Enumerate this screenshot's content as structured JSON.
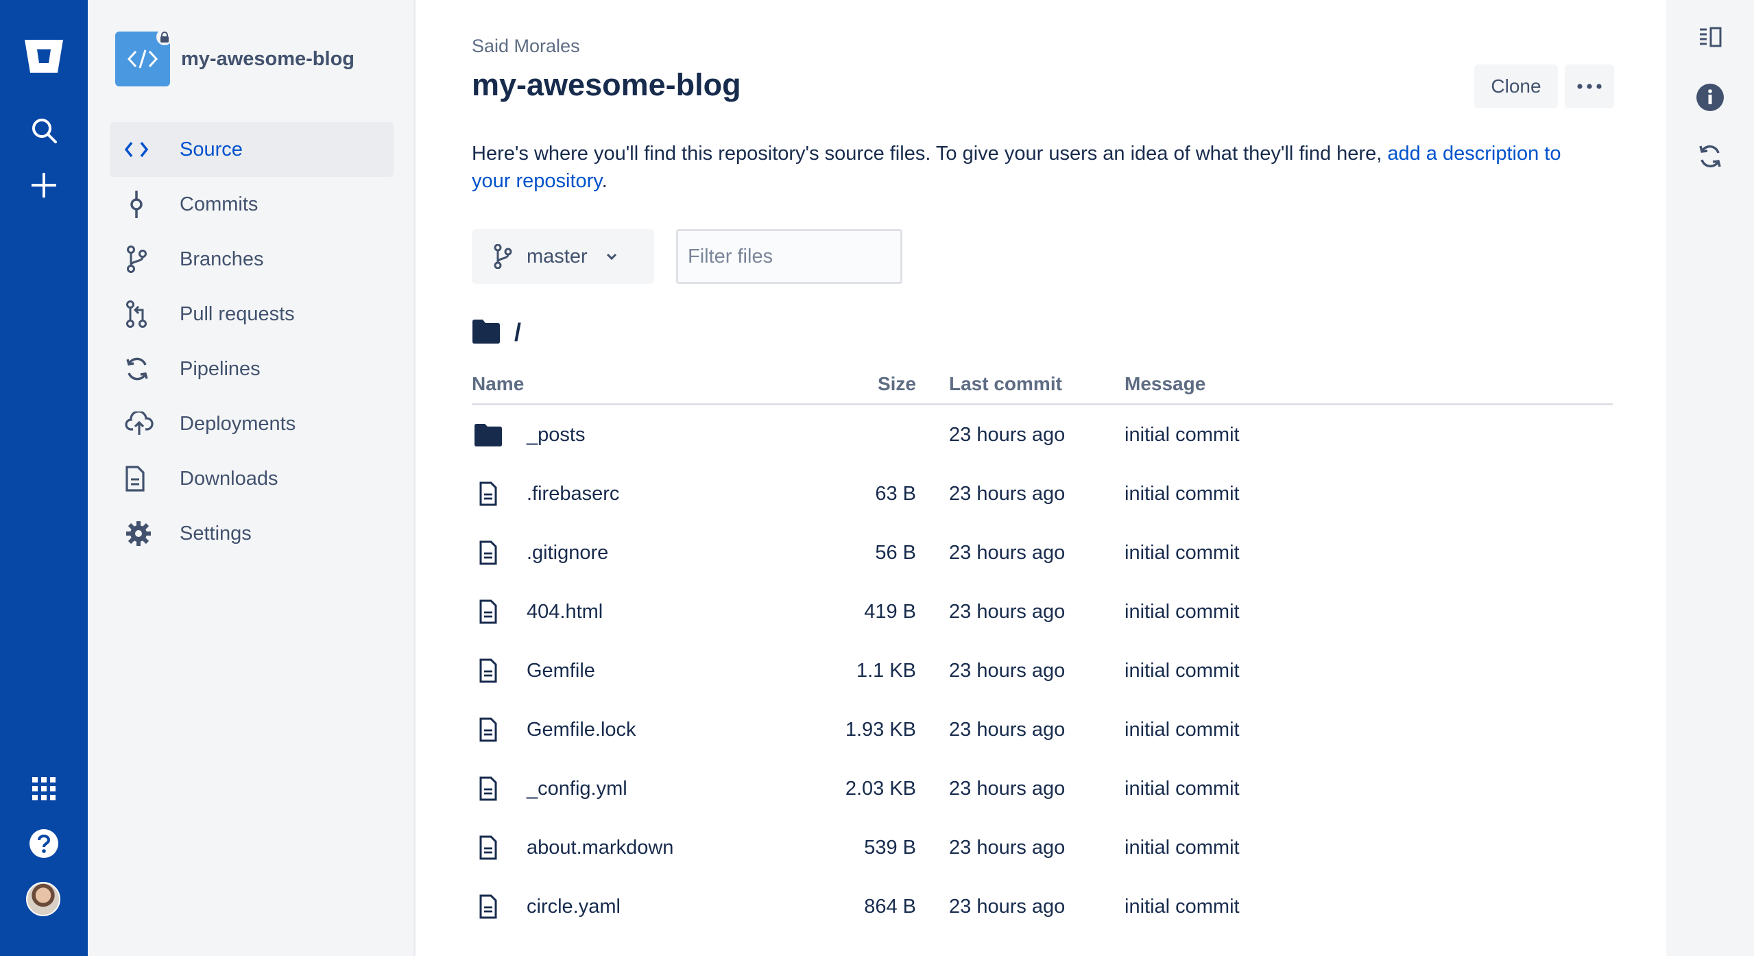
{
  "sidebar": {
    "repo_name": "my-awesome-blog",
    "items": [
      {
        "label": "Source",
        "icon": "source-code-icon"
      },
      {
        "label": "Commits",
        "icon": "commit-icon"
      },
      {
        "label": "Branches",
        "icon": "branch-icon"
      },
      {
        "label": "Pull requests",
        "icon": "pull-request-icon"
      },
      {
        "label": "Pipelines",
        "icon": "pipelines-icon"
      },
      {
        "label": "Deployments",
        "icon": "deployments-icon"
      },
      {
        "label": "Downloads",
        "icon": "downloads-icon"
      },
      {
        "label": "Settings",
        "icon": "gear-icon"
      }
    ]
  },
  "header": {
    "owner": "Said Morales",
    "title": "my-awesome-blog",
    "clone_label": "Clone"
  },
  "description": {
    "text": "Here's where you'll find this repository's source files. To give your users an idea of what they'll find here, ",
    "link": "add a description to your repository",
    "end": "."
  },
  "branch": {
    "name": "master"
  },
  "filter": {
    "placeholder": "Filter files"
  },
  "breadcrumb": {
    "path": "/"
  },
  "table": {
    "headers": {
      "name": "Name",
      "size": "Size",
      "last_commit": "Last commit",
      "message": "Message"
    },
    "rows": [
      {
        "type": "folder",
        "name": "_posts",
        "size": "",
        "last_commit": "23 hours ago",
        "message": "initial commit"
      },
      {
        "type": "file",
        "name": ".firebaserc",
        "size": "63 B",
        "last_commit": "23 hours ago",
        "message": "initial commit"
      },
      {
        "type": "file",
        "name": ".gitignore",
        "size": "56 B",
        "last_commit": "23 hours ago",
        "message": "initial commit"
      },
      {
        "type": "file",
        "name": "404.html",
        "size": "419 B",
        "last_commit": "23 hours ago",
        "message": "initial commit"
      },
      {
        "type": "file",
        "name": "Gemfile",
        "size": "1.1 KB",
        "last_commit": "23 hours ago",
        "message": "initial commit"
      },
      {
        "type": "file",
        "name": "Gemfile.lock",
        "size": "1.93 KB",
        "last_commit": "23 hours ago",
        "message": "initial commit"
      },
      {
        "type": "file",
        "name": "_config.yml",
        "size": "2.03 KB",
        "last_commit": "23 hours ago",
        "message": "initial commit"
      },
      {
        "type": "file",
        "name": "about.markdown",
        "size": "539 B",
        "last_commit": "23 hours ago",
        "message": "initial commit"
      },
      {
        "type": "file",
        "name": "circle.yaml",
        "size": "864 B",
        "last_commit": "23 hours ago",
        "message": "initial commit"
      }
    ]
  },
  "colors": {
    "global_nav": "#0747a6",
    "link": "#0052cc",
    "sidebar_bg": "#f4f5f7",
    "text": "#172b4d"
  }
}
